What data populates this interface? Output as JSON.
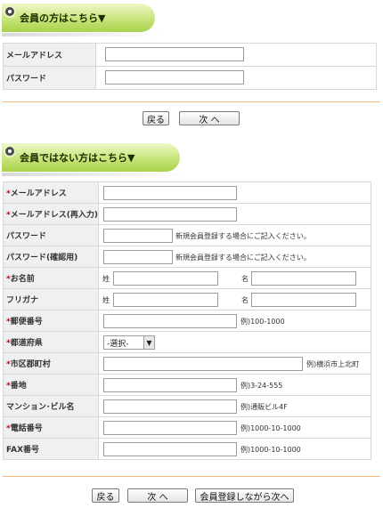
{
  "member_section": {
    "title": "会員の方はこちら▼",
    "rows": [
      {
        "label": "メールアドレス",
        "value": ""
      },
      {
        "label": "パスワード",
        "value": ""
      }
    ],
    "back_label": "戻る",
    "next_label": "次 へ"
  },
  "nonmember_section": {
    "title": "会員ではない方はこちら▼",
    "required_mark": "*",
    "rows": {
      "email": {
        "label": "メールアドレス",
        "required": true
      },
      "email_confirm": {
        "label": "メールアドレス(再入力)",
        "required": true
      },
      "password": {
        "label": "パスワード",
        "note": "新規会員登録する場合にご記入ください。"
      },
      "password_confirm": {
        "label": "パスワード(確認用)",
        "note": "新規会員登録する場合にご記入ください。"
      },
      "name": {
        "label": "お名前",
        "required": true,
        "sei": "姓",
        "mei": "名"
      },
      "furigana": {
        "label": "フリガナ",
        "sei": "姓",
        "mei": "名"
      },
      "zip": {
        "label": "郵便番号",
        "required": true,
        "note": "例)100-1000"
      },
      "prefecture": {
        "label": "都道府県",
        "required": true,
        "selected": "-選択-"
      },
      "city": {
        "label": "市区郡町村",
        "required": true,
        "note": "例)横浜市上北町"
      },
      "address": {
        "label": "番地",
        "required": true,
        "note": "例)3-24-555"
      },
      "building": {
        "label": "マンション･ビル名",
        "note": "例)通販ビル4F"
      },
      "phone": {
        "label": "電話番号",
        "required": true,
        "note": "例)1000-10-1000"
      },
      "fax": {
        "label": "FAX番号",
        "note": "例)1000-10-1000"
      }
    },
    "back_label": "戻る",
    "next_label": "次 へ",
    "register_label": "会員登録しながら次へ"
  },
  "colors": {
    "tab_green": "#c7e57a",
    "required_red": "#d50000",
    "divider_orange": "#f3b97a"
  }
}
